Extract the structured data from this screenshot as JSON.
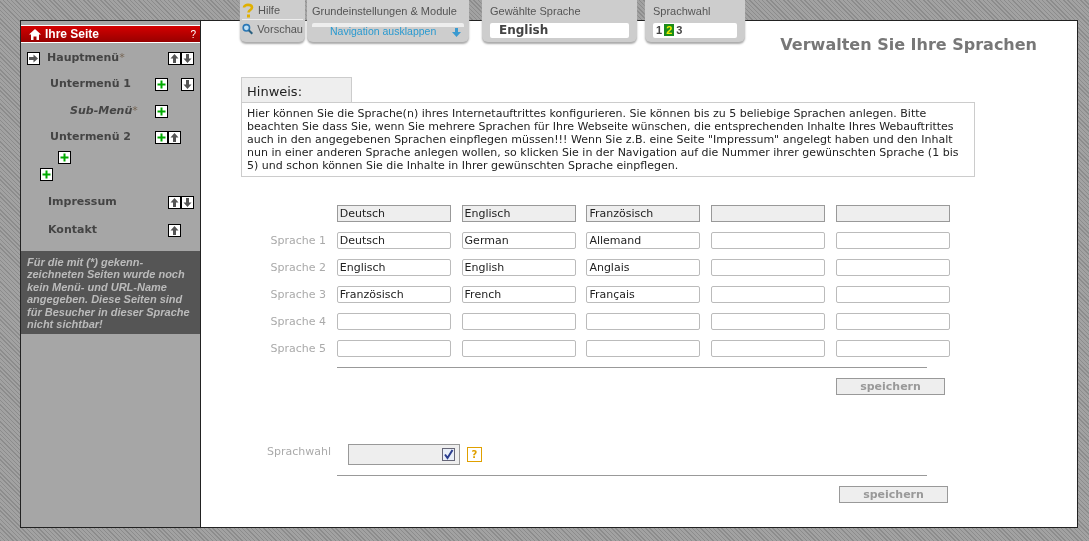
{
  "toolbar": {
    "help": "Hilfe",
    "preview": "Vorschau",
    "settings": "Grundeinstellungen & Module",
    "navigation": "Navigation ausklappen",
    "language_label": "Gewählte Sprache",
    "language_value": "English",
    "switch_label": "Sprachwahl",
    "languages": [
      {
        "label": "1",
        "selected": false
      },
      {
        "label": "2",
        "selected": true
      },
      {
        "label": "3",
        "selected": false
      }
    ]
  },
  "sidebar": {
    "title": "Ihre Seite",
    "help": "?",
    "items": [
      {
        "kind": "main",
        "label": "Hauptmenü",
        "star": "*",
        "selected": true,
        "controls": [
          {
            "kind": "gap"
          },
          {
            "kind": "up"
          },
          {
            "kind": "down"
          }
        ]
      },
      {
        "kind": "sub",
        "label": "Untermenü 1",
        "selected": false,
        "controls": [
          {
            "kind": "add"
          },
          {
            "kind": "gap"
          },
          {
            "kind": "down"
          }
        ]
      },
      {
        "kind": "subsub",
        "label": "Sub-Menü",
        "star": "*",
        "selected": false,
        "controls": [
          {
            "kind": "add"
          }
        ]
      },
      {
        "kind": "sub",
        "label": "Untermenü 2",
        "selected": false,
        "controls": [
          {
            "kind": "add"
          },
          {
            "kind": "up"
          }
        ]
      },
      {
        "kind": "add-inner",
        "controls": [
          {
            "kind": "add"
          }
        ]
      },
      {
        "kind": "add-outer",
        "controls": [
          {
            "kind": "add"
          }
        ]
      },
      {
        "kind": "main",
        "label": "Impressum",
        "selected": false,
        "controls": [
          {
            "kind": "gap"
          },
          {
            "kind": "up"
          },
          {
            "kind": "down"
          }
        ]
      },
      {
        "kind": "main",
        "label": "Kontakt",
        "selected": false,
        "controls": [
          {
            "kind": "gap"
          },
          {
            "kind": "up"
          }
        ]
      }
    ],
    "note": "Für die mit (*) gekenn-zeichneten Seiten wurde noch kein Menü- und URL-Name angegeben. Diese Seiten sind für Besucher in dieser Sprache nicht sichtbar!"
  },
  "main": {
    "title": "Verwalten Sie Ihre Sprachen",
    "hint": {
      "title": "Hinweis:",
      "text": "Hier können Sie die Sprache(n) ihres Internetauftrittes konfigurieren. Sie können bis zu 5 beliebige Sprachen anlegen. Bitte beachten Sie dass Sie, wenn Sie mehrere Sprachen für Ihre Webseite wünschen, die entsprechenden Inhalte Ihres Webauftrittes auch in den angegebenen Sprachen einpflegen müssen!!! Wenn Sie z.B. eine Seite \"Impressum\" angelegt haben und den Inhalt nun in einer anderen Sprache anlegen wollen, so klicken Sie in der Navigation auf die Nummer ihrer gewünschten Sprache (1 bis 5) und schon können Sie die Inhalte in Ihrer gewünschten Sprache einpflegen."
    },
    "table": {
      "headers": [
        "Deutsch",
        "Englisch",
        "Französisch"
      ],
      "rows": [
        {
          "label": "Sprache 1",
          "values": [
            "Deutsch",
            "German",
            "Allemand"
          ]
        },
        {
          "label": "Sprache 2",
          "values": [
            "Englisch",
            "English",
            "Anglais"
          ]
        },
        {
          "label": "Sprache 3",
          "values": [
            "Französisch",
            "French",
            "Français"
          ]
        },
        {
          "label": "Sprache 4",
          "values": []
        },
        {
          "label": "Sprache 5",
          "values": []
        }
      ]
    },
    "save_languages": "speichern",
    "selector": {
      "label": "Sprachwahl",
      "checked": true,
      "help": "?"
    },
    "save_selector": "speichern"
  }
}
